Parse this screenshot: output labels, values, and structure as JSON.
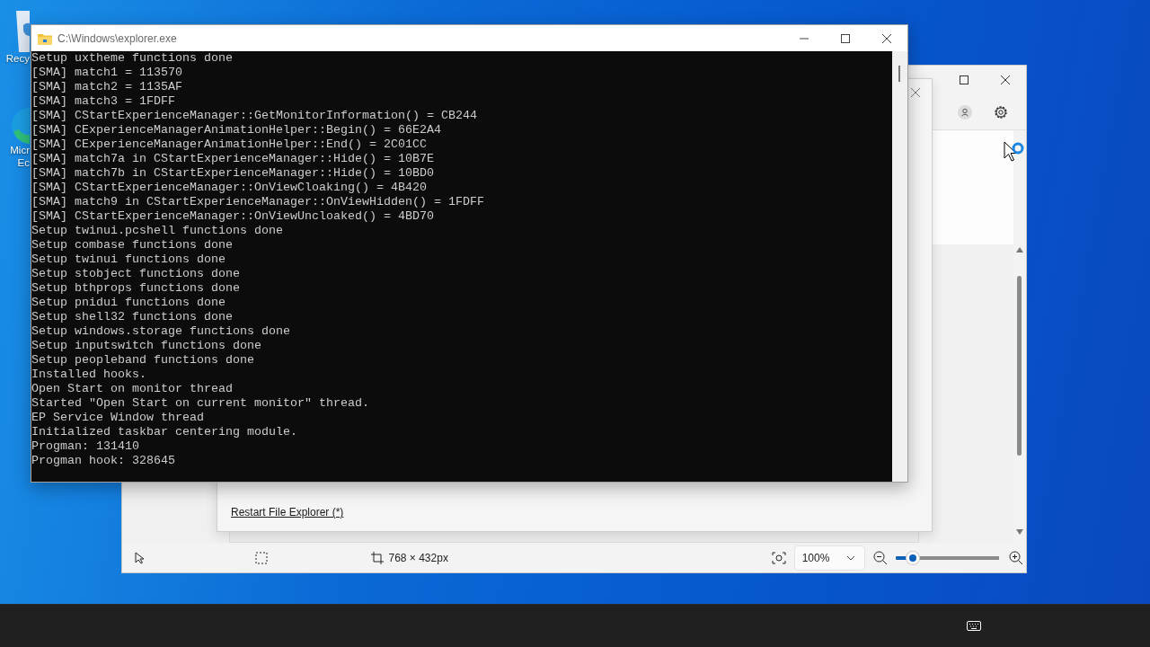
{
  "desktop_icons": [
    {
      "lines": [
        "Recy"
      ]
    },
    {
      "lines": [
        "Micr",
        "Ec"
      ]
    }
  ],
  "snip_window": {
    "bottom_bar": {
      "dimensions": "768 × 432px",
      "zoom": "100%",
      "zoom_slider": {
        "level": 0.16
      }
    }
  },
  "dialog": {
    "link": "Restart File Explorer (*)"
  },
  "console": {
    "title": "C:\\Windows\\explorer.exe",
    "lines": [
      "Setup uxtheme functions done",
      "[SMA] match1 = 113570",
      "[SMA] match2 = 1135AF",
      "[SMA] match3 = 1FDFF",
      "[SMA] CStartExperienceManager::GetMonitorInformation() = CB244",
      "[SMA] CExperienceManagerAnimationHelper::Begin() = 66E2A4",
      "[SMA] CExperienceManagerAnimationHelper::End() = 2C01CC",
      "[SMA] match7a in CStartExperienceManager::Hide() = 10B7E",
      "[SMA] match7b in CStartExperienceManager::Hide() = 10BD0",
      "[SMA] CStartExperienceManager::OnViewCloaking() = 4B420",
      "[SMA] match9 in CStartExperienceManager::OnViewHidden() = 1FDFF",
      "[SMA] CStartExperienceManager::OnViewUncloaked() = 4BD70",
      "Setup twinui.pcshell functions done",
      "Setup combase functions done",
      "Setup twinui functions done",
      "Setup stobject functions done",
      "Setup bthprops functions done",
      "Setup pnidui functions done",
      "Setup shell32 functions done",
      "Setup windows.storage functions done",
      "Setup inputswitch functions done",
      "Setup peopleband functions done",
      "Installed hooks.",
      "Open Start on monitor thread",
      "Started \"Open Start on current monitor\" thread.",
      "EP Service Window thread",
      "Initialized taskbar centering module.",
      "Progman: 131410",
      "Progman hook: 328645"
    ]
  }
}
